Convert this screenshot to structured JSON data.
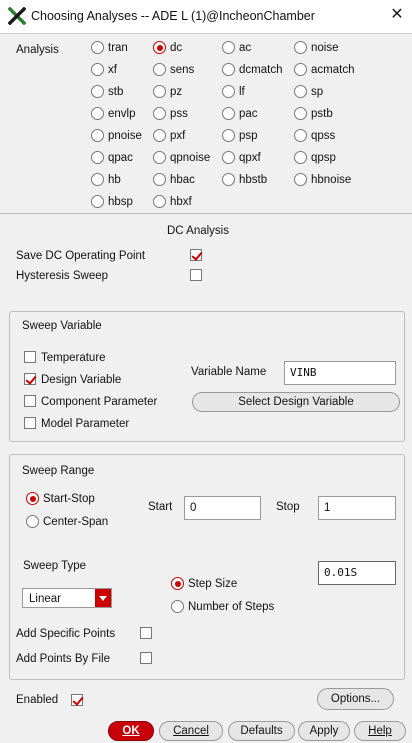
{
  "window": {
    "title": "Choosing Analyses -- ADE L (1)@IncheonChamber"
  },
  "analysis": {
    "label": "Analysis",
    "options": [
      "tran",
      "dc",
      "ac",
      "noise",
      "xf",
      "sens",
      "dcmatch",
      "acmatch",
      "stb",
      "pz",
      "lf",
      "sp",
      "envlp",
      "pss",
      "pac",
      "pstb",
      "pnoise",
      "pxf",
      "psp",
      "qpss",
      "qpac",
      "qpnoise",
      "qpxf",
      "qpsp",
      "hb",
      "hbac",
      "hbstb",
      "hbnoise",
      "hbsp",
      "hbxf"
    ],
    "selected": "dc"
  },
  "dc": {
    "heading": "DC Analysis",
    "save_op_label": "Save DC Operating Point",
    "save_op_checked": true,
    "hysteresis_label": "Hysteresis Sweep",
    "hysteresis_checked": false
  },
  "sweep_variable": {
    "title": "Sweep Variable",
    "options": [
      {
        "label": "Temperature",
        "checked": false
      },
      {
        "label": "Design Variable",
        "checked": true
      },
      {
        "label": "Component Parameter",
        "checked": false
      },
      {
        "label": "Model Parameter",
        "checked": false
      }
    ],
    "variable_name_label": "Variable Name",
    "variable_name_value": "VINB",
    "select_button": "Select Design Variable"
  },
  "sweep_range": {
    "title": "Sweep Range",
    "mode_start_stop": "Start-Stop",
    "mode_center_span": "Center-Span",
    "selected_mode": "Start-Stop",
    "start_label": "Start",
    "start_value": "0",
    "stop_label": "Stop",
    "stop_value": "1",
    "sweep_type_label": "Sweep Type",
    "sweep_type_value": "Linear",
    "step_size_label": "Step Size",
    "number_of_steps_label": "Number of Steps",
    "step_selected": "Step Size",
    "step_value": "0.01S",
    "add_specific_points_label": "Add Specific Points",
    "add_specific_points_checked": false,
    "add_points_by_file_label": "Add Points By File",
    "add_points_by_file_checked": false
  },
  "enabled_label": "Enabled",
  "enabled_checked": true,
  "buttons": {
    "options": "Options...",
    "ok": "OK",
    "cancel": "Cancel",
    "defaults": "Defaults",
    "apply": "Apply",
    "help": "Help"
  },
  "colors": {
    "accent": "#c8000a",
    "background": "#f0f0f0",
    "title_bar": "#ffffff"
  },
  "icons": {
    "app": "x-logo-icon",
    "close": "close-icon",
    "dropdown": "chevron-down-icon"
  }
}
